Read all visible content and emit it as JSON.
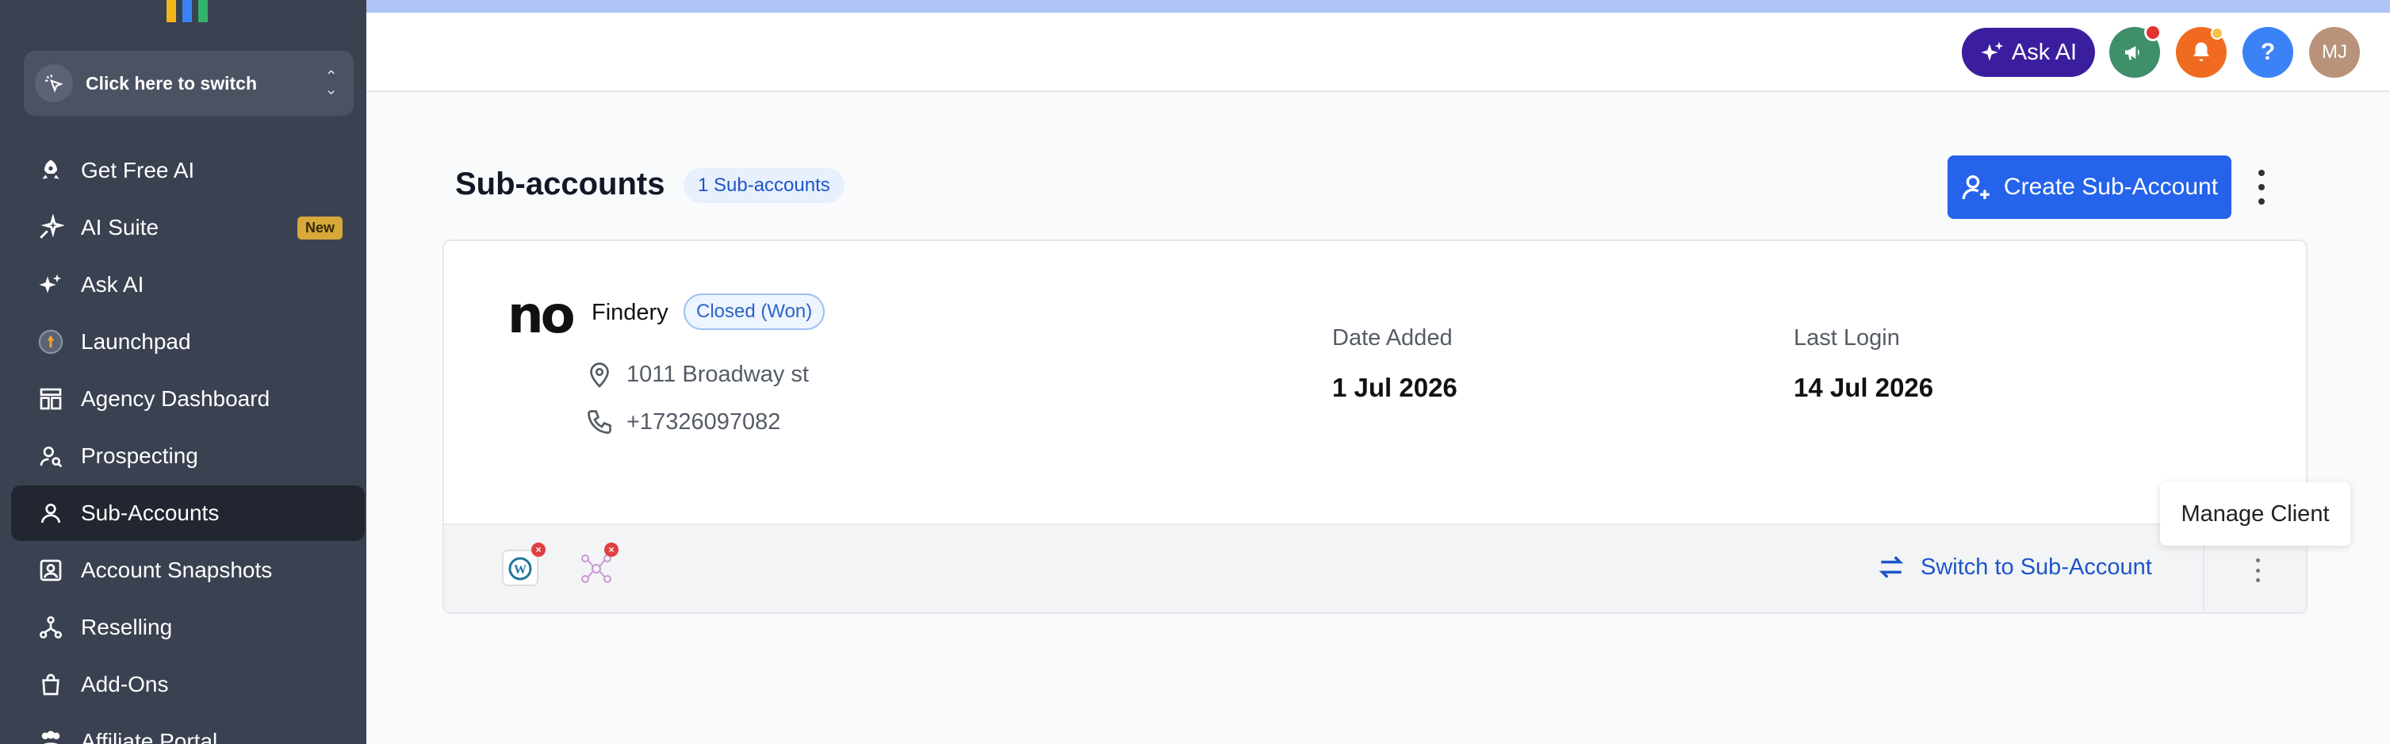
{
  "sidebar": {
    "switcher_label": "Click here to switch",
    "items": [
      {
        "label": "Get Free AI",
        "icon": "rocket-icon"
      },
      {
        "label": "AI Suite",
        "icon": "sparkle-icon",
        "badge": "New"
      },
      {
        "label": "Ask AI",
        "icon": "stars-icon"
      },
      {
        "label": "Launchpad",
        "icon": "launchpad-icon"
      },
      {
        "label": "Agency Dashboard",
        "icon": "dashboard-icon"
      },
      {
        "label": "Prospecting",
        "icon": "prospecting-icon"
      },
      {
        "label": "Sub-Accounts",
        "icon": "user-icon",
        "active": true
      },
      {
        "label": "Account Snapshots",
        "icon": "snapshot-icon"
      },
      {
        "label": "Reselling",
        "icon": "reselling-icon"
      },
      {
        "label": "Add-Ons",
        "icon": "bag-icon"
      },
      {
        "label": "Affiliate Portal",
        "icon": "affiliate-icon"
      }
    ]
  },
  "header": {
    "ask_ai_label": "Ask AI",
    "help_label": "?",
    "avatar_initials": "MJ"
  },
  "main": {
    "title": "Sub-accounts",
    "count_badge": "1 Sub-accounts",
    "create_button": "Create Sub-Account"
  },
  "account": {
    "logo_text": "no",
    "name": "Findery",
    "status": "Closed (Won)",
    "address": "1011 Broadway st",
    "phone": "+17326097082",
    "date_added_label": "Date Added",
    "date_added": "1 Jul 2026",
    "last_login_label": "Last Login",
    "last_login": "14 Jul 2026",
    "switch_label": "Switch to Sub-Account",
    "tooltip": "Manage Client"
  },
  "colors": {
    "sidebar_bg": "#3a4150",
    "accent": "#2563eb",
    "ask_ai_bg": "#3b1e9e",
    "announce_bg": "#3f8f6b",
    "bell_bg": "#f06b1f",
    "help_bg": "#3b82f6",
    "avatar_bg": "#b8937a"
  }
}
